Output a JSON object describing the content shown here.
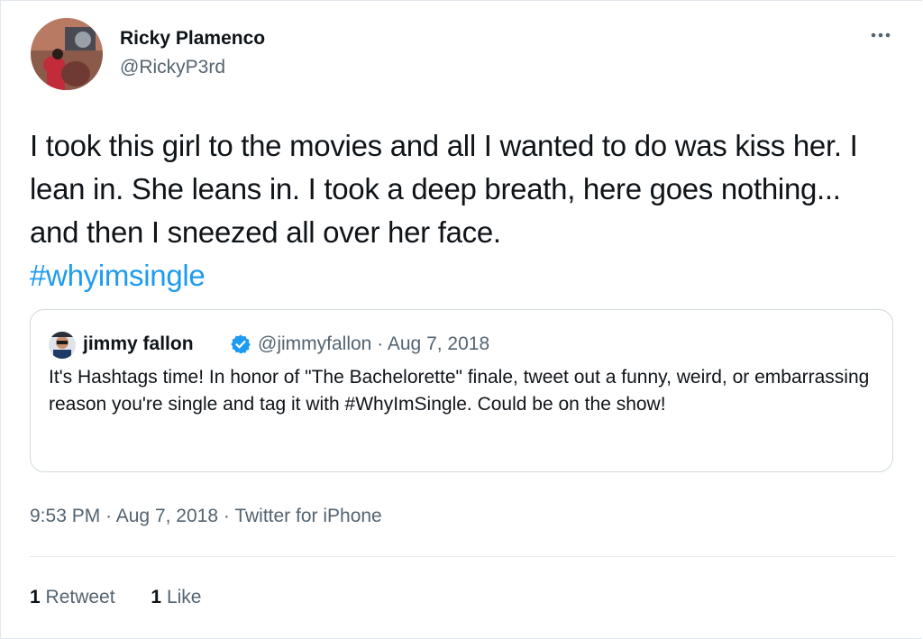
{
  "author": {
    "display_name": "Ricky Plamenco",
    "handle": "@RickyP3rd"
  },
  "tweet": {
    "text_before_hashtag": "I took this girl to the movies and all I wanted to do was kiss her. I lean in. She leans in. I took a deep breath, here goes nothing... and then I sneezed all over her face.",
    "hashtag": "#whyimsingle"
  },
  "quoted_tweet": {
    "display_name": "jimmy fallon",
    "handle": "@jimmyfallon",
    "separator": "·",
    "date": "Aug 7, 2018",
    "text": "It's Hashtags time! In honor of \"The Bachelorette\" finale, tweet out a funny, weird, or embarrassing reason you're single and tag it with #WhyImSingle. Could be on the show!",
    "verified": true
  },
  "meta": {
    "time": "9:53 PM",
    "separator": "·",
    "date": "Aug 7, 2018",
    "source": "Twitter for iPhone"
  },
  "stats": {
    "retweet_count": "1",
    "retweet_label": "Retweet",
    "like_count": "1",
    "like_label": "Like"
  },
  "colors": {
    "hashtag": "#1d9bf0",
    "secondary_text": "#536471",
    "verified_badge": "#1d9bf0"
  },
  "icons": [
    "avatar",
    "more-options-icon",
    "verified-badge-icon"
  ]
}
